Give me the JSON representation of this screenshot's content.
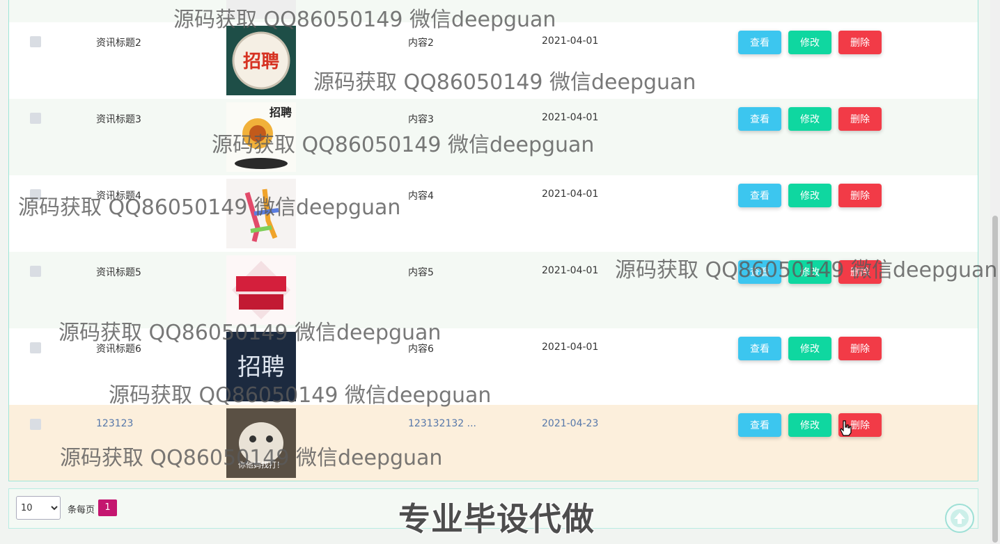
{
  "table": {
    "rows": [
      {
        "title": "",
        "content": "",
        "date": ""
      },
      {
        "title": "资讯标题2",
        "content": "内容2",
        "date": "2021-04-01"
      },
      {
        "title": "资讯标题3",
        "content": "内容3",
        "date": "2021-04-01"
      },
      {
        "title": "资讯标题4",
        "content": "内容4",
        "date": "2021-04-01"
      },
      {
        "title": "资讯标题5",
        "content": "内容5",
        "date": "2021-04-01"
      },
      {
        "title": "资讯标题6",
        "content": "内容6",
        "date": "2021-04-01"
      },
      {
        "title": "123123",
        "content": "123132132 ...",
        "date": "2021-04-23"
      }
    ],
    "actions": {
      "view": "查看",
      "edit": "修改",
      "delete": "删除"
    },
    "thumbnails": {
      "row2": "招聘",
      "row3": "招聘",
      "row6": "招聘",
      "row7": "你他妈找打！"
    }
  },
  "pagination": {
    "page_size": "10",
    "page_size_options": [
      "10"
    ],
    "per_page_label": "条每页",
    "current_page": "1"
  },
  "watermark": "源码获取 QQ86050149 微信deepguan",
  "promo_text": "专业毕设代做",
  "colors": {
    "view": "#3cc6ef",
    "edit": "#0fd7a0",
    "delete": "#f23b47",
    "page_active": "#c4166f",
    "highlight_row": "#fcefdc"
  },
  "icons": [
    "back-to-top-icon",
    "hand-cursor-icon"
  ]
}
